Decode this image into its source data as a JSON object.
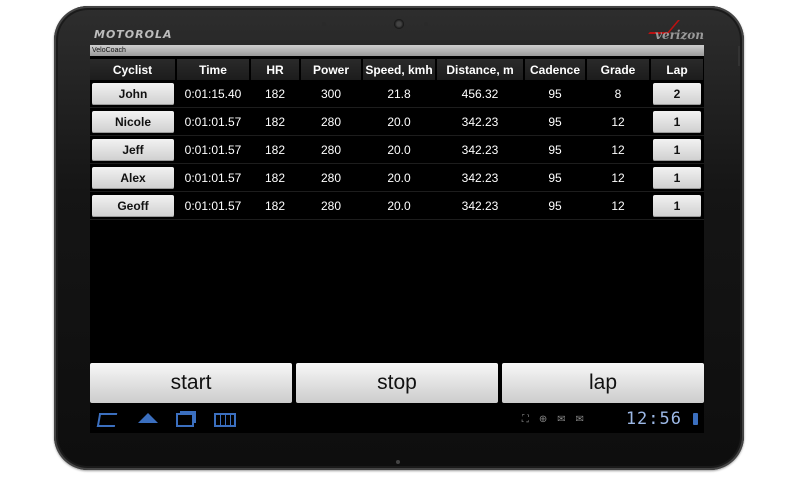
{
  "device": {
    "brand": "MOTOROLA",
    "carrier": "verizon"
  },
  "app": {
    "title": "VeloCoach"
  },
  "table": {
    "headers": [
      "Cyclist",
      "Time",
      "HR",
      "Power",
      "Speed, kmh",
      "Distance, m",
      "Cadence",
      "Grade",
      "Lap"
    ],
    "rows": [
      {
        "cyclist": "John",
        "time": "0:01:15.40",
        "hr": "182",
        "power": "300",
        "speed": "21.8",
        "distance": "456.32",
        "cadence": "95",
        "grade": "8",
        "lap": "2"
      },
      {
        "cyclist": "Nicole",
        "time": "0:01:01.57",
        "hr": "182",
        "power": "280",
        "speed": "20.0",
        "distance": "342.23",
        "cadence": "95",
        "grade": "12",
        "lap": "1"
      },
      {
        "cyclist": "Jeff",
        "time": "0:01:01.57",
        "hr": "182",
        "power": "280",
        "speed": "20.0",
        "distance": "342.23",
        "cadence": "95",
        "grade": "12",
        "lap": "1"
      },
      {
        "cyclist": "Alex",
        "time": "0:01:01.57",
        "hr": "182",
        "power": "280",
        "speed": "20.0",
        "distance": "342.23",
        "cadence": "95",
        "grade": "12",
        "lap": "1"
      },
      {
        "cyclist": "Geoff",
        "time": "0:01:01.57",
        "hr": "182",
        "power": "280",
        "speed": "20.0",
        "distance": "342.23",
        "cadence": "95",
        "grade": "12",
        "lap": "1"
      }
    ]
  },
  "actions": {
    "start": "start",
    "stop": "stop",
    "lap": "lap"
  },
  "system_bar": {
    "clock": "12:56",
    "accent_color": "#3b6fbf",
    "icons": [
      "back-icon",
      "home-icon",
      "recent-apps-icon",
      "menu-icon",
      "screenshot-icon",
      "usb-icon",
      "mail-icon",
      "mail-icon",
      "bluetooth-icon",
      "wifi-icon",
      "battery-icon"
    ]
  }
}
